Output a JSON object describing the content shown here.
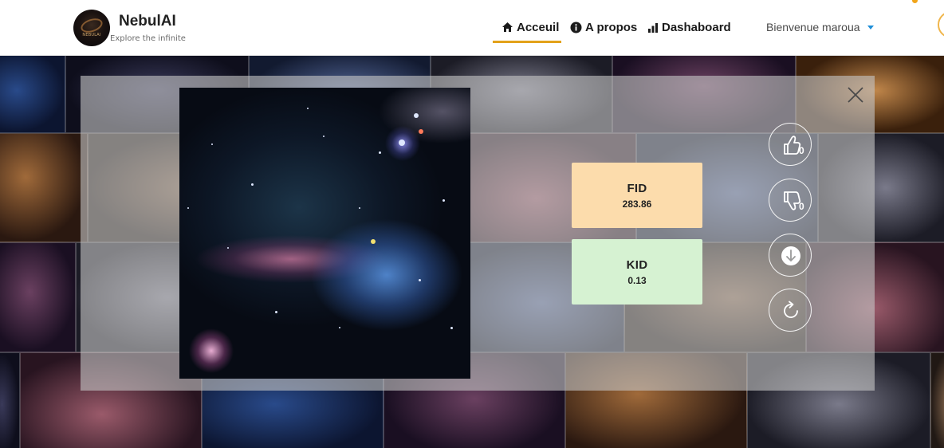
{
  "header": {
    "brand_name": "NebulAI",
    "brand_tagline": "Explore the infinite",
    "logo_caption": "NEBULAI",
    "nav": [
      {
        "label": "Acceuil",
        "icon": "home-icon",
        "active": true
      },
      {
        "label": "A propos",
        "icon": "info-icon",
        "active": false
      },
      {
        "label": "Dashaboard",
        "icon": "bar-chart-icon",
        "active": false
      }
    ],
    "user_greeting": "Bienvenue maroua",
    "accent_color": "#e3a21a"
  },
  "modal": {
    "close_icon": "close-icon",
    "image_alt": "generated nebula image",
    "metrics": [
      {
        "label": "FID",
        "value": "283.86",
        "color": "#fcdcac"
      },
      {
        "label": "KID",
        "value": "0.13",
        "color": "#d6f2d2"
      }
    ],
    "actions": {
      "like": {
        "icon": "thumbs-up-icon",
        "count": "0"
      },
      "dislike": {
        "icon": "thumbs-down-icon",
        "count": "0"
      },
      "download": {
        "icon": "download-icon"
      },
      "regenerate": {
        "icon": "refresh-icon"
      }
    }
  }
}
